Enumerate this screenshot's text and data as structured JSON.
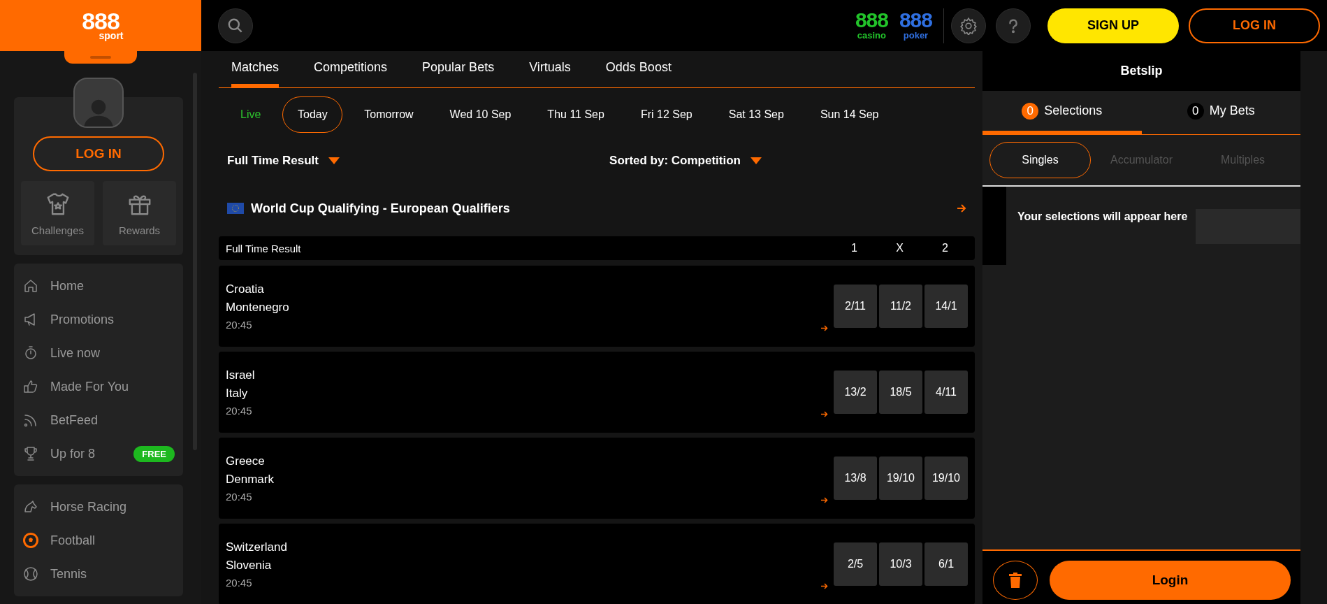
{
  "logo": {
    "number": "888",
    "sub": "sport"
  },
  "header": {
    "brands": [
      {
        "number": "888",
        "label": "casino",
        "color": "#22c32a"
      },
      {
        "number": "888",
        "label": "poker",
        "color": "#2f6fe0"
      }
    ],
    "buttons": [
      {
        "label": "SIGN UP",
        "kind": "primary"
      },
      {
        "label": "LOG IN",
        "kind": "outline"
      }
    ]
  },
  "sidebar": {
    "login_button": "LOG IN",
    "tiles": [
      {
        "label": "Challenges"
      },
      {
        "label": "Rewards"
      }
    ],
    "nav": [
      {
        "label": "Home"
      },
      {
        "label": "Promotions"
      },
      {
        "label": "Live now"
      },
      {
        "label": "Made For You"
      },
      {
        "label": "BetFeed"
      },
      {
        "label": "Up for 8",
        "badge": "FREE"
      }
    ],
    "sports": [
      {
        "label": "Horse Racing"
      },
      {
        "label": "Football"
      },
      {
        "label": "Tennis"
      }
    ]
  },
  "tabs": [
    {
      "label": "Matches",
      "selected": true
    },
    {
      "label": "Competitions",
      "selected": false
    },
    {
      "label": "Popular Bets",
      "selected": false
    },
    {
      "label": "Virtuals",
      "selected": false
    },
    {
      "label": "Odds Boost",
      "selected": false
    }
  ],
  "dates": [
    {
      "label": "Live",
      "kind": "live",
      "selected": false
    },
    {
      "label": "Today",
      "kind": "date",
      "selected": true
    },
    {
      "label": "Tomorrow",
      "kind": "date",
      "selected": false
    },
    {
      "label": "Wed 10 Sep",
      "kind": "date",
      "selected": false
    },
    {
      "label": "Thu 11 Sep",
      "kind": "date",
      "selected": false
    },
    {
      "label": "Fri 12 Sep",
      "kind": "date",
      "selected": false
    },
    {
      "label": "Sat 13 Sep",
      "kind": "date",
      "selected": false
    },
    {
      "label": "Sun 14 Sep",
      "kind": "date",
      "selected": false
    }
  ],
  "filters": {
    "market": "Full Time Result",
    "sort": "Sorted by: Competition"
  },
  "competition": {
    "name": "World Cup Qualifying - European Qualifiers"
  },
  "table": {
    "label": "Full Time Result",
    "columns": [
      "1",
      "X",
      "2"
    ]
  },
  "matches": [
    {
      "home": "Croatia",
      "away": "Montenegro",
      "time": "20:45",
      "odds": [
        "2/11",
        "11/2",
        "14/1"
      ]
    },
    {
      "home": "Israel",
      "away": "Italy",
      "time": "20:45",
      "odds": [
        "13/2",
        "18/5",
        "4/11"
      ]
    },
    {
      "home": "Greece",
      "away": "Denmark",
      "time": "20:45",
      "odds": [
        "13/8",
        "19/10",
        "19/10"
      ]
    },
    {
      "home": "Switzerland",
      "away": "Slovenia",
      "time": "20:45",
      "odds": [
        "2/5",
        "10/3",
        "6/1"
      ]
    }
  ],
  "betslip": {
    "title": "Betslip",
    "tabs": [
      {
        "count": "0",
        "label": "Selections",
        "selected": true
      },
      {
        "count": "0",
        "label": "My Bets",
        "selected": false
      }
    ],
    "bet_types": [
      {
        "label": "Singles",
        "selected": true
      },
      {
        "label": "Accumulator",
        "selected": false
      },
      {
        "label": "Multiples",
        "selected": false
      }
    ],
    "empty_message": "Your selections will appear here",
    "login_button": "Login"
  }
}
